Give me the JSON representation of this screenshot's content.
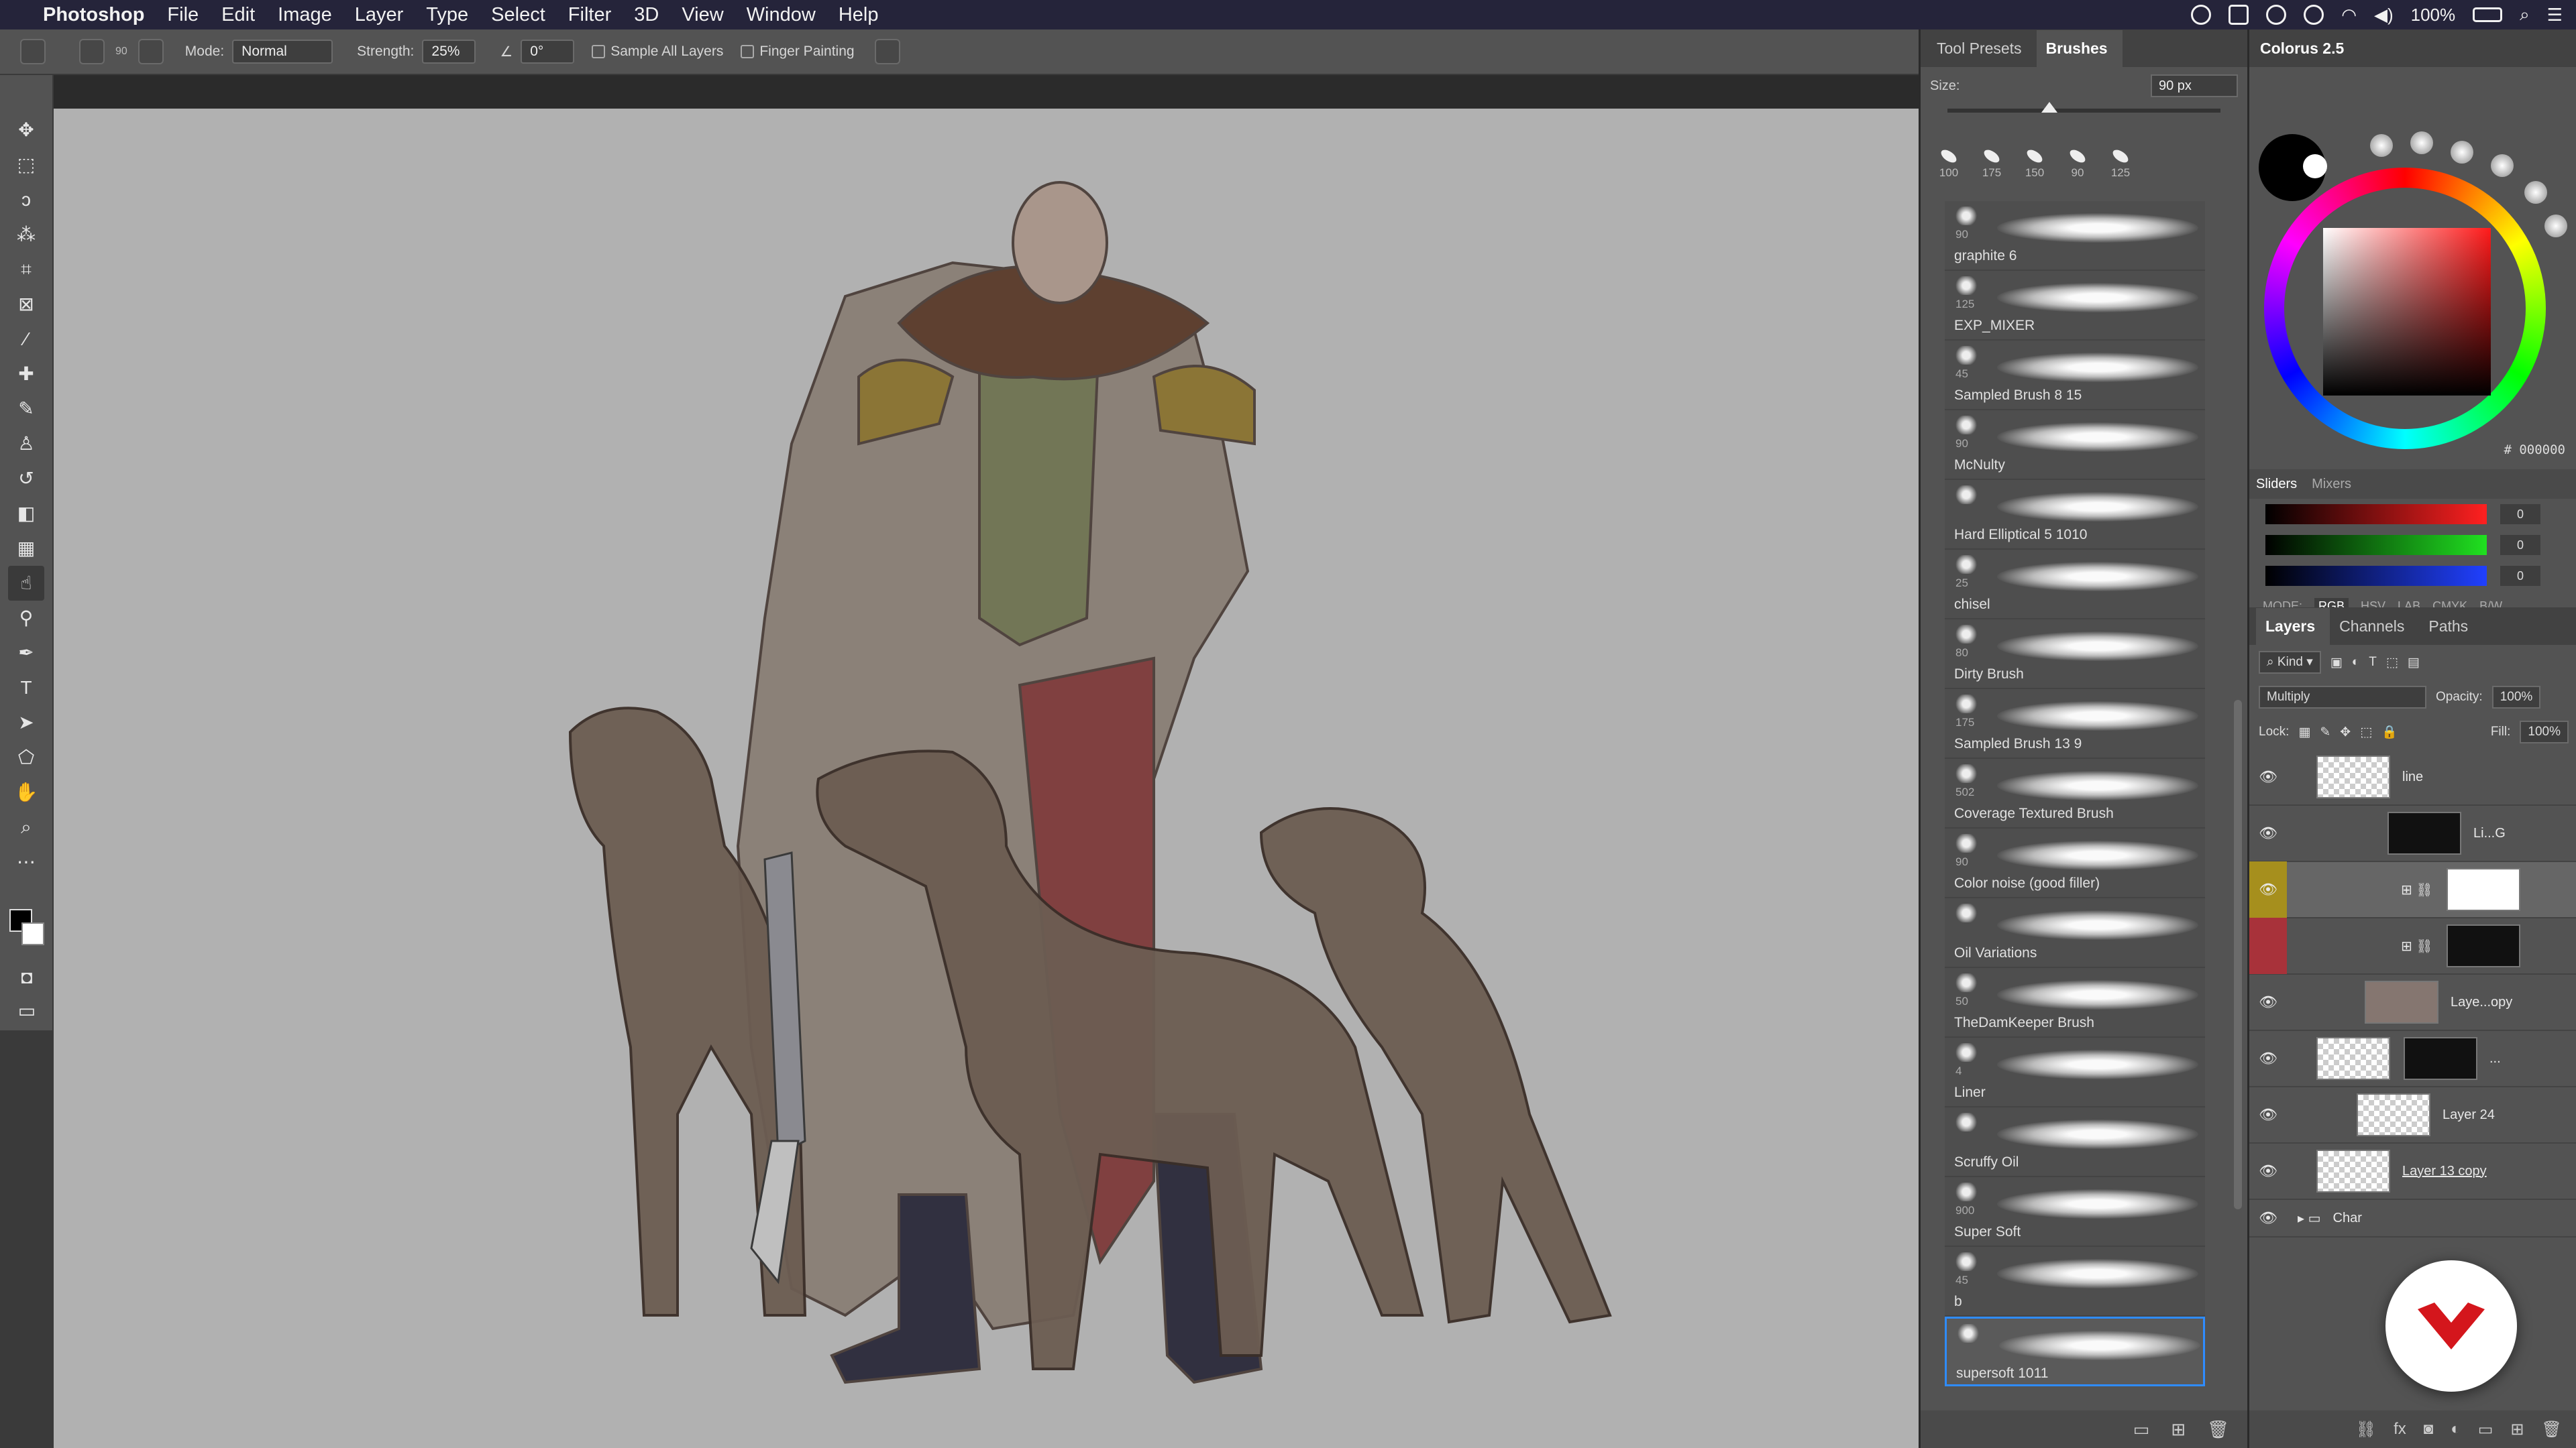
{
  "menubar": {
    "app": "Photoshop",
    "menus": [
      "File",
      "Edit",
      "Image",
      "Layer",
      "Type",
      "Select",
      "Filter",
      "3D",
      "View",
      "Window",
      "Help"
    ],
    "battery": "100%"
  },
  "options": {
    "brush_size": "90",
    "mode_label": "Mode:",
    "mode_value": "Normal",
    "strength_label": "Strength:",
    "strength_value": "25%",
    "angle_value": "0°",
    "sample_all": "Sample All Layers",
    "finger": "Finger Painting"
  },
  "brushes_panel": {
    "tab1": "Tool Presets",
    "tab2": "Brushes",
    "size_label": "Size:",
    "size_value": "90 px",
    "recent": [
      "100",
      "175",
      "150",
      "90",
      "125"
    ],
    "list": [
      {
        "num": "90",
        "name": "graphite 6"
      },
      {
        "num": "125",
        "name": "EXP_MIXER"
      },
      {
        "num": "45",
        "name": "Sampled Brush 8 15"
      },
      {
        "num": "90",
        "name": "McNulty"
      },
      {
        "num": "",
        "name": "Hard Elliptical 5 1010"
      },
      {
        "num": "25",
        "name": "chisel"
      },
      {
        "num": "80",
        "name": "Dirty Brush"
      },
      {
        "num": "175",
        "name": "Sampled Brush 13 9"
      },
      {
        "num": "502",
        "name": "Coverage Textured Brush"
      },
      {
        "num": "90",
        "name": "Color noise (good filler)"
      },
      {
        "num": "",
        "name": "Oil Variations"
      },
      {
        "num": "50",
        "name": "TheDamKeeper Brush"
      },
      {
        "num": "4",
        "name": "Liner"
      },
      {
        "num": "",
        "name": "Scruffy Oil"
      },
      {
        "num": "900",
        "name": "Super Soft"
      },
      {
        "num": "45",
        "name": "b"
      },
      {
        "num": "",
        "name": "supersoft 1011"
      }
    ]
  },
  "colorus": {
    "title": "Colorus 2.5",
    "hex": "000000",
    "tab_sliders": "Sliders",
    "tab_mixers": "Mixers",
    "slider_vals": [
      "0",
      "0",
      "0"
    ],
    "mode_label": "MODE:",
    "modes": [
      "RGB",
      "HSV",
      "LAB",
      "CMYK",
      "B/W"
    ]
  },
  "layers": {
    "tab1": "Layers",
    "tab2": "Channels",
    "tab3": "Paths",
    "kind": "Kind",
    "blend": "Multiply",
    "opacity_label": "Opacity:",
    "opacity": "100%",
    "lock_label": "Lock:",
    "fill_label": "Fill:",
    "fill": "100%",
    "rows": [
      {
        "name": "line"
      },
      {
        "name": "Li...G"
      },
      {
        "name": ""
      },
      {
        "name": ""
      },
      {
        "name": "Laye...opy"
      },
      {
        "name": "..."
      },
      {
        "name": "Layer 24"
      },
      {
        "name": "Layer 13 copy"
      },
      {
        "name": "Char"
      }
    ]
  }
}
